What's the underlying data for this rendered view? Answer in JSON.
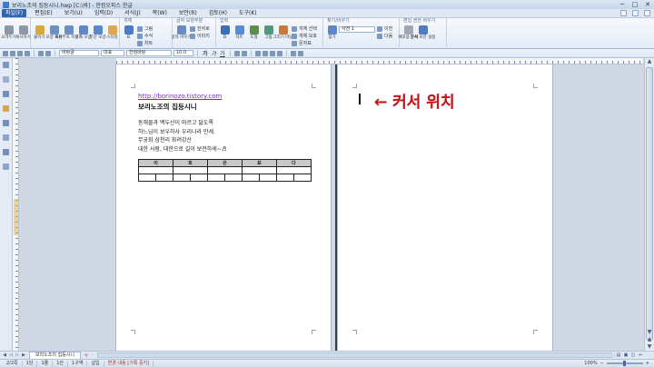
{
  "window": {
    "title": "보리노조의 집등시니.hwp [C:\\바] - 한컴오피스 한글",
    "minimize": "─",
    "maximize": "□",
    "close": "✕"
  },
  "menu": {
    "items": [
      "파일(F)",
      "편집(E)",
      "보기(U)",
      "입력(D)",
      "서식(J)",
      "쪽(W)",
      "보안(R)",
      "검토(H)",
      "도구(K)"
    ],
    "active_index": 0
  },
  "ribbon": {
    "groups": [
      {
        "title": "",
        "buttons": [
          {
            "label": "오려두기",
            "color": "#8c98a8"
          },
          {
            "label": "복사하기",
            "color": "#8c98a8"
          }
        ]
      },
      {
        "title": "",
        "buttons": [
          {
            "label": "붙이기",
            "color": "#d8a83a"
          },
          {
            "label": "모양 복사",
            "color": "#6d8fc2"
          },
          {
            "label": "조판부호 지우기",
            "color": "#6d8fc2"
          },
          {
            "label": "글자 모양",
            "color": "#5f86c6"
          },
          {
            "label": "문단 모양",
            "color": "#5f86c6"
          },
          {
            "label": "스타일",
            "color": "#e0a84a"
          }
        ]
      },
      {
        "title": "개체",
        "buttons": [
          {
            "label": "표",
            "color": "#4f7cc0"
          }
        ],
        "rows": [
          "그림",
          "수식",
          "차트"
        ]
      },
      {
        "title": "글자 모양부분",
        "buttons": [
          {
            "label": "글자 바꾸기",
            "color": "#6a8cc1"
          }
        ],
        "rows": [
          "한자로",
          "이미지"
        ]
      },
      {
        "title": "입력",
        "buttons": [
          {
            "label": "표",
            "color": "#3f6eb5"
          },
          {
            "label": "차트",
            "color": "#5a8ad0"
          },
          {
            "label": "도형",
            "color": "#5f8d4e"
          },
          {
            "label": "그림",
            "color": "#4f9a7a"
          },
          {
            "label": "그리기 마당",
            "color": "#c77a3a"
          }
        ],
        "rows": [
          "개체 선택",
          "개체 보호",
          "문자표"
        ]
      },
      {
        "title": "찾기/바꾸기",
        "buttons": [
          {
            "label": "찾기",
            "color": "#5f86c6"
          }
        ],
        "dropdown": "사전 1",
        "rows": [
          "이전",
          "다음"
        ]
      },
      {
        "title": "편집 권한 바꾸기",
        "buttons": [
          {
            "label": "배포용 문서",
            "color": "#a0a8b4"
          },
          {
            "label": "문서 보안 설정",
            "color": "#4f7cc0"
          }
        ]
      }
    ]
  },
  "format_toolbar": {
    "style": "바탕글",
    "language": "대표",
    "font": "한컴바탕",
    "size": "10.0",
    "bold": "가",
    "italic": "가",
    "underline": "가"
  },
  "page1": {
    "link": "http://borinozo.tistory.com",
    "title": "보리노조의 집등시니",
    "lines": [
      "동해물과 백두산이 마르고 닳도록",
      "하느님이 보우하사 우리나라 만세.",
      "무궁화 삼천리 화려강산",
      "대한 사람, 대한으로 길이 보전하세~♬"
    ],
    "table_headers": [
      "이",
      "호",
      "은",
      "표",
      "다"
    ]
  },
  "page2": {
    "annotation": "← 커서 위치"
  },
  "tab_bar": {
    "doc_tab": "보리노조의 집등시니",
    "add_tab": "+"
  },
  "status_bar": {
    "page": "2/2쪽",
    "section": "1단",
    "line": "1줄",
    "col": "1칸",
    "sections": "1구역",
    "insert": "삽입",
    "change": "변경 내용 [기록 중지]",
    "zoom": "100%"
  },
  "colors": {
    "annotation": "#c0181a",
    "link": "#7a2ec0",
    "menu_active": "#2f64b1"
  }
}
